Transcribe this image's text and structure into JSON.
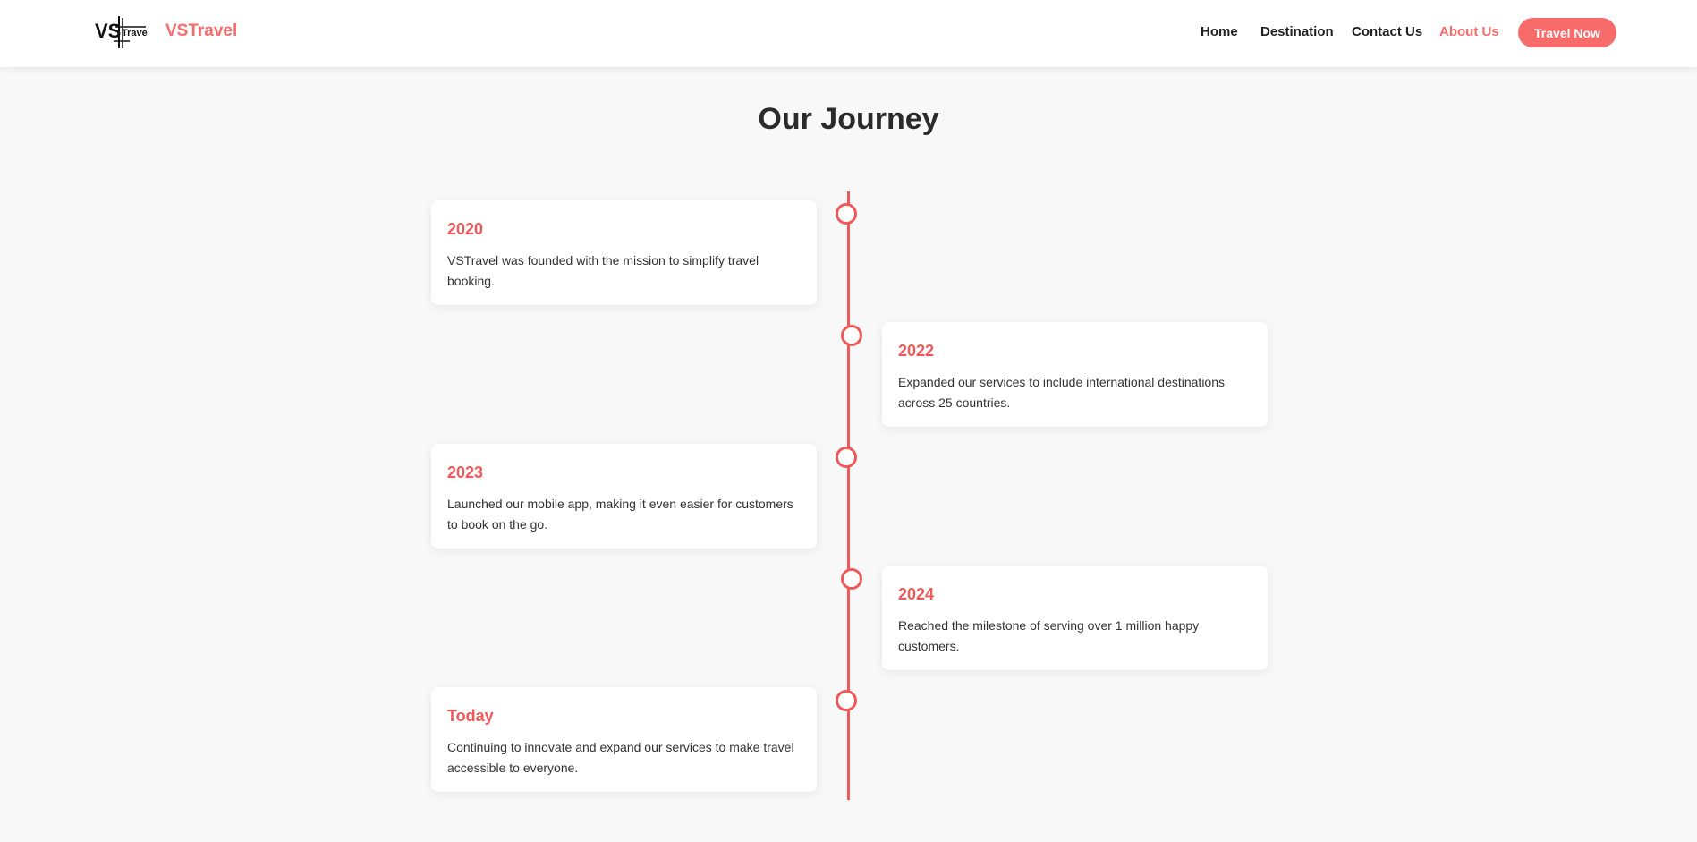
{
  "nav": {
    "brand": "VSTravel",
    "logo_text": "VS Travel",
    "links": [
      {
        "label": "Home",
        "active": false
      },
      {
        "label": "Destination",
        "active": false
      },
      {
        "label": "Contact Us",
        "active": false
      },
      {
        "label": "About Us",
        "active": true
      }
    ],
    "cta_label": "Travel Now"
  },
  "page": {
    "title": "Our Journey"
  },
  "timeline": [
    {
      "year": "2020",
      "text": "VSTravel was founded with the mission to simplify travel booking."
    },
    {
      "year": "2022",
      "text": "Expanded our services to include international destinations across 25 countries."
    },
    {
      "year": "2023",
      "text": "Launched our mobile app, making it even easier for customers to book on the go."
    },
    {
      "year": "2024",
      "text": "Reached the milestone of serving over 1 million happy customers."
    },
    {
      "year": "Today",
      "text": "Continuing to innovate and expand our services to make travel accessible to everyone."
    }
  ],
  "colors": {
    "accent": "#f76b6b",
    "timeline": "#ee5a5a",
    "background": "#f8f8f8"
  }
}
